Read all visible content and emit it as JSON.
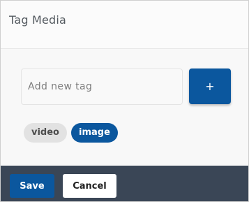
{
  "dialog": {
    "title": "Tag Media"
  },
  "tag_input": {
    "placeholder": "Add new tag",
    "value": ""
  },
  "add_button": {
    "label": "+",
    "icon": "plus-icon"
  },
  "tags": [
    {
      "label": "video",
      "selected": false
    },
    {
      "label": "image",
      "selected": true
    }
  ],
  "footer": {
    "save_label": "Save",
    "cancel_label": "Cancel"
  },
  "colors": {
    "accent": "#0b579e",
    "footer_bg": "#3a4656",
    "chip_inactive": "#e2e2e2"
  }
}
